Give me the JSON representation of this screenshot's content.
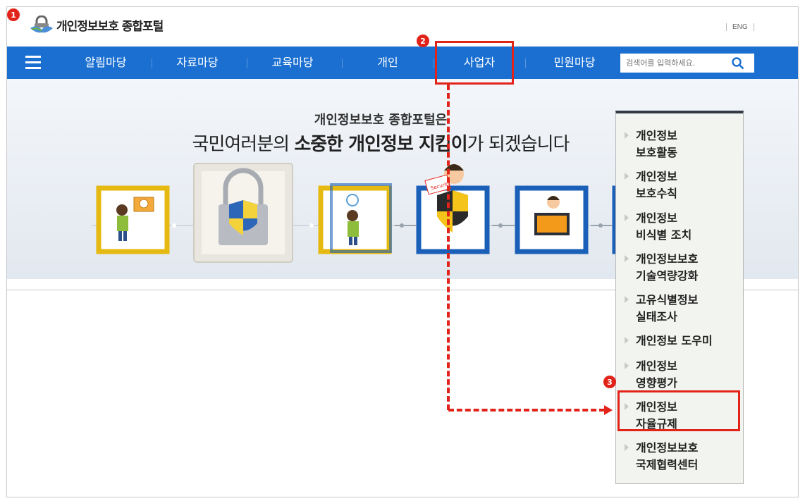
{
  "site": {
    "logo_text": "개인정보보호 종합포털",
    "lang_link": "ENG"
  },
  "nav": {
    "items": [
      {
        "label": "알림마당"
      },
      {
        "label": "자료마당"
      },
      {
        "label": "교육마당"
      },
      {
        "label": "개인"
      },
      {
        "label": "사업자"
      },
      {
        "label": "민원마당"
      }
    ],
    "search_placeholder": "검색어를 입력하세요."
  },
  "hero": {
    "subtitle": "개인정보보호 종합포털은",
    "title_part1": "국민여러분의 ",
    "title_bold1": "소중한 개인정보 지킴이",
    "title_part2": "가 되겠습니다",
    "shield_badge": "Security"
  },
  "dropdown": {
    "items": [
      {
        "line1": "개인정보",
        "line2": "보호활동"
      },
      {
        "line1": "개인정보",
        "line2": "보호수칙"
      },
      {
        "line1": "개인정보",
        "line2": "비식별 조치"
      },
      {
        "line1": "개인정보보호",
        "line2": "기술역량강화"
      },
      {
        "line1": "고유식별정보",
        "line2": "실태조사"
      },
      {
        "line1": "개인정보 도우미",
        "line2": ""
      },
      {
        "line1": "개인정보",
        "line2": "영향평가"
      },
      {
        "line1": "개인정보",
        "line2": "자율규제"
      },
      {
        "line1": "개인정보보호",
        "line2": "국제협력센터"
      }
    ]
  },
  "annotations": {
    "step1": "1",
    "step2": "2",
    "step3": "3"
  },
  "colors": {
    "nav_bg": "#1a6fd1",
    "highlight": "#e2231a",
    "dropdown_bg": "#f2f5ef"
  }
}
